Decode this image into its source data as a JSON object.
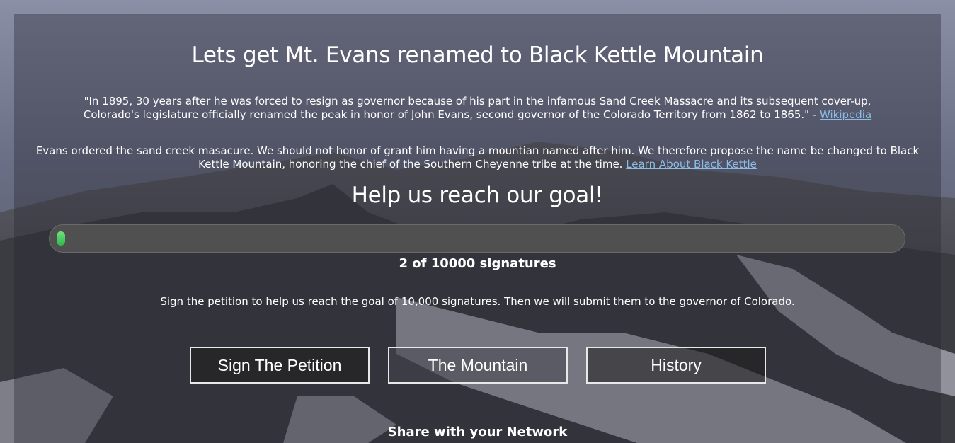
{
  "hero": {
    "title": "Lets get Mt. Evans renamed to Black Kettle Mountain",
    "quote_text": "\"In 1895, 30 years after he was forced to resign as governor because of his part in the infamous Sand Creek Massacre and its subsequent cover-up, Colorado's legislature officially renamed the peak in honor of John Evans, second governor of the Colorado Territory from 1862 to 1865.\" - ",
    "quote_link": "Wikipedia",
    "proposal_text": "Evans ordered the sand creek masacure. We should not honor of grant him having a mountian named after him. We therefore propose the name be changed to Black Kettle Mountain, honoring the chief of the Southern Cheyenne tribe at the time. ",
    "proposal_link": "Learn About Black Kettle"
  },
  "goal": {
    "heading": "Help us reach our goal!",
    "signatures": 2,
    "target": 10000,
    "count_text": "2 of 10000 signatures",
    "fill_color": "#3ccc55",
    "description": "Sign the petition to help us reach the goal of 10,000 signatures. Then we will submit them to the governor of Colorado."
  },
  "buttons": {
    "sign": "Sign The Petition",
    "mountain": "The Mountain",
    "history": "History"
  },
  "footer": {
    "share": "Share with your Network"
  }
}
